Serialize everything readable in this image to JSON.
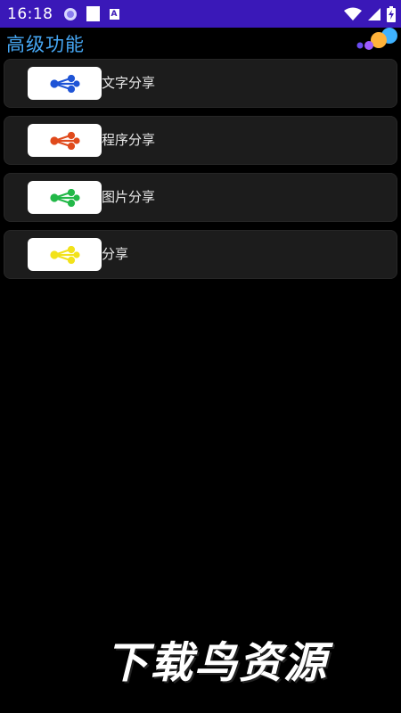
{
  "status_bar": {
    "time": "16:18",
    "icons": [
      "notification-ring-icon",
      "notification-square-icon",
      "notification-a-icon",
      "wifi-icon",
      "signal-icon",
      "battery-charging-icon"
    ]
  },
  "app_bar": {
    "title": "高级功能"
  },
  "items": [
    {
      "label": "文字分享",
      "color": "#1f54d6",
      "icon": "share-icon"
    },
    {
      "label": "程序分享",
      "color": "#e04a1c",
      "icon": "share-icon"
    },
    {
      "label": "图片分享",
      "color": "#22b848",
      "icon": "share-icon"
    },
    {
      "label": "分享",
      "color": "#f2e21a",
      "icon": "share-icon"
    }
  ],
  "watermark": {
    "text": "下载鸟资源"
  },
  "colors": {
    "status_bar": "#3a18b8",
    "title": "#46a7f4",
    "background": "#000000",
    "card": "#1c1c1c"
  }
}
